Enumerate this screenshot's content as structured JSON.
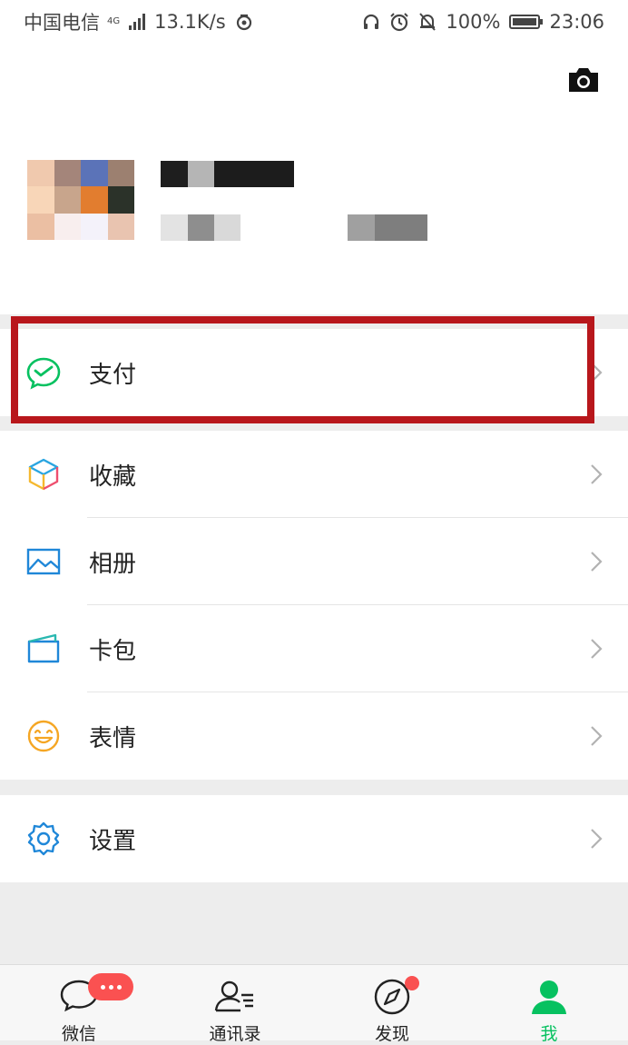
{
  "status_bar": {
    "carrier": "中国电信",
    "network_tag": "4G",
    "speed": "13.1K/s",
    "battery": "100%",
    "time": "23:06"
  },
  "menu": {
    "pay": "支付",
    "favorites": "收藏",
    "album": "相册",
    "cards": "卡包",
    "stickers": "表情",
    "settings": "设置"
  },
  "tabs": {
    "chats": "微信",
    "contacts": "通讯录",
    "discover": "发现",
    "me": "我"
  },
  "icons": {
    "camera": "camera-icon",
    "pay": "wechat-pay-icon",
    "favorites": "cube-icon",
    "album": "picture-icon",
    "cards": "wallet-card-icon",
    "stickers": "smiley-icon",
    "settings": "gear-icon",
    "chevron": "chevron-right-icon"
  },
  "colors": {
    "accent_green": "#07c160",
    "badge_red": "#fa5151",
    "highlight_red": "#b8171c"
  }
}
